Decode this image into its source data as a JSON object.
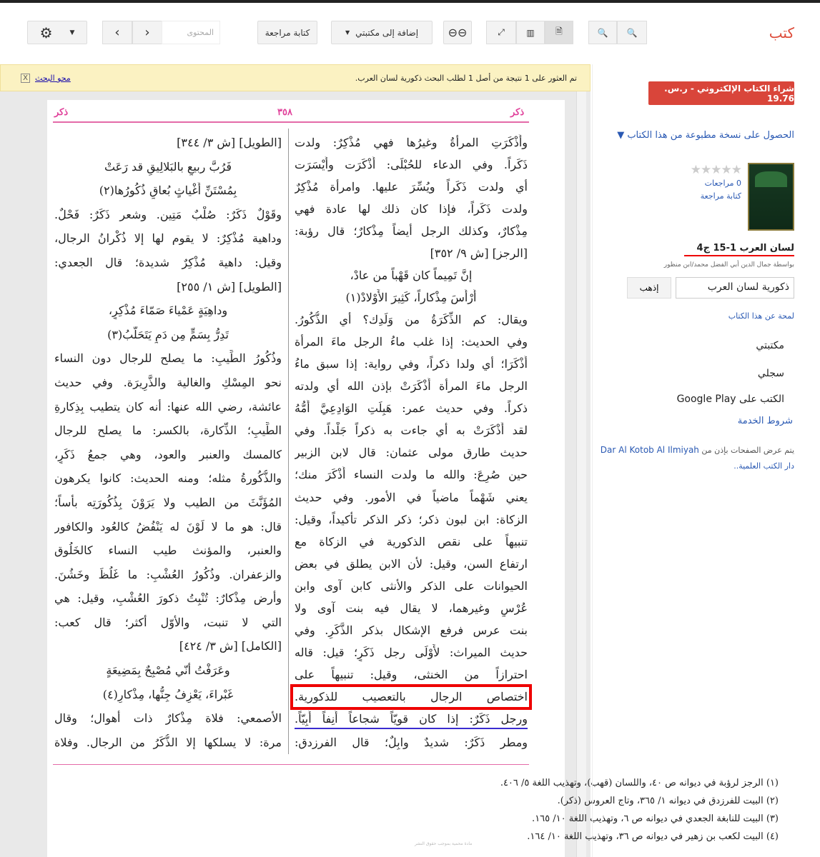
{
  "toolbar": {
    "logo": "كتب",
    "zoom_in": "zoom-in",
    "zoom_out": "zoom-out",
    "link": "link",
    "write_review": "كتابة مراجعة",
    "add_library": "إضافة إلى مكتبتي",
    "content_placeholder": "المحتوى"
  },
  "notice": {
    "msg": "تم العثور على 1 نتيجة من أصل 1 لطلب البحث ذكورية لسان العرب.",
    "clear": "محو البحث",
    "close": "X"
  },
  "page": {
    "header_left": "ذكر",
    "header_center": "٣٥٨",
    "header_right": "ذكر",
    "right_col": [
      "وأَذْكَرَتِ المرأةُ وغيرُها فهي مُذْكِرٌ: ولدت",
      "ذَكَراً. وفي الدعاء للحُبْلَى: أَذْكَرَت وأَيْسَرَت",
      "أي ولدت ذَكَراً ويُسِّرَ عليها. وامرأة مُذْكِرٌ",
      "ولدت ذَكَراً، فإذا كان ذلك لها عادة فهي",
      "مِذْكارٌ، وكذلك الرجل أيضاً مِذْكارٌ؛ قال رؤبة:",
      "[الرجز] [ش ٩/ ٣٥٢]",
      "إنَّ تَمِيماً كان قَهْباً من عادْ،",
      "أَرْأَسَ مِذْكاراً، كَثِيرَ الأَوْلادْ(١)",
      "ويقال: كم الذِّكَرَةُ من وَلَدِك؟ أي الذُّكُورُ.",
      "وفي الحديث: إذا غلب ماءُ الرجل ماءَ المرأة",
      "أَذْكَرَا؛ أي ولدا ذكراً، وفي رواية: إذا سبق ماءُ",
      "الرجل ماءَ المرأة أَذْكَرَتْ بإذن الله أي ولدته",
      "ذكراً. وفي حديث عمر: هَبِلَتِ الوَادِعِيَّ أُمُّهُ",
      "لقد أَذْكَرَتْ به أي جاءت به ذكراً جَلْداً. وفي",
      "حديث طارق مولى عثمان: قال لابن الزبير",
      "حين صُرِعَ: والله ما ولدت النساء أَذْكَرَ منك؛",
      "يعني شَهْماً ماضياً في الأمور. وفي حديث",
      "الزكاة: ابن لبون ذكر؛ ذكر الذكر تأكيداً، وقيل:",
      "تنبيهاً على نقص الذكورية في الزكاة مع",
      "ارتفاع السن، وقيل: لأن الابن يطلق في بعض",
      "الحيوانات على الذكر والأنثى كابن آوى وابن",
      "عُرْسٍ وغيرهما، لا يقال فيه بنت آوى ولا",
      "بنت عرس فرفع الإشكال بذكر الذَّكَرِ. وفي",
      "حديث الميراث: لأَوْلَى رجل ذَكَرٍ؛ قيل: قاله",
      "احترازاً من الخنثى، وقيل: تنبيهاً على",
      "اختصاص الرجال بالتعصيب للذكورية.",
      "ورجل ذَكَرٌ: إذا كان قويّاً شجاعاً أَنِفاً أَبِيّاً.",
      "ومطر ذَكَرٌ: شديدٌ وابِلٌ؛ قال الفرزدق:"
    ],
    "left_col": [
      "[الطويل] [ش ٣/ ٣٤٤]",
      "فَرُبَّ ربيعٍ بالبَلالِيقِ قد رَعَتْ",
      "بِمُسْتَنِّ أَغْياثٍ بُعاقٍ ذُكُورُها(٢)",
      "وقَوْلٌ ذَكَرٌ: صُلْبٌ مَتِين. وشعر ذَكَرٌ: فَحْلٌ.",
      "وداهية مُذْكِرٌ: لا يقوم لها إلا ذُكْرانُ الرجال،",
      "وقيل: داهية مُذْكِرٌ شديدة؛ قال الجعدي:",
      "[الطويل] [ش ١/ ٢٥٥]",
      "وداهِيَةٍ عَمْياءَ صَمّاءَ مُذْكِرٍ،",
      "تَدِرُّ بِسَمٍّ مِن دَمٍ يَتَحَلَّبُ(٣)",
      "وذُكُورُ الطِّيبِ: ما يصلح للرجال دون النساء",
      "نحو المِسْكِ والغالية والذَّرِيرَة. وفي حديث",
      "عائشة، رضي الله عنها: أنه كان يتطيب بِذِكارةِ",
      "الطِّيبِ؛ الذِّكارة، بالكسر: ما يصلح للرجال",
      "كالمسك والعنبر والعود، وهي جمعُ ذَكَرٍ،",
      "والذُّكُورةُ مثله؛ ومنه الحديث: كانوا يكرهون",
      "المُؤَنَّثَ من الطيب ولا يَرَوْنَ بِذُكُورَتِه بأساً؛",
      "قال: هو ما لا لَوْنَ له يَنْفُضُ كالعُود والكافور",
      "والعنبر، والمؤنث طيب النساء كالخَلُوق",
      "والزعفران. وذُكُورُ العُشْبِ: ما غَلُظَ وخَشُنَ.",
      "وأرض مِذْكارٌ: تُنْبِتُ ذكورَ العُشْبِ، وقيل: هي",
      "التي لا تنبت، والأوّل أكثر؛ قال كعب:",
      "[الكامل] [ش ٣/ ٤٢٤]",
      "وعَرَفْتُ أنّي مُصْبِحٌ بِمَضِيعَةٍ",
      "غَبْراءَ، يَعْزِفُ جِنُّها، مِذْكارِ(٤)",
      "الأصمعي: فلاة مِذْكارٌ ذات أهوال؛ وقال",
      "مرة: لا يسلكها إلا الذُّكَرُ من الرجال. وفلاة"
    ],
    "footnotes": [
      "(١) الرجز لرؤبة في ديوانه ص ٤٠، واللسان (قهب)، وتهذيب اللغة ٥/ ٤٠٦.",
      "(٢) البيت للفرزدق في ديوانه ١/ ٣٦٥، وتاج العروس (ذكر).",
      "(٣) البيت للنابغة الجعدي في ديوانه ص ٦، وتهذيب اللغة ١٠/ ١٦٥.",
      "(٤) البيت لكعب بن زهير في ديوانه ص ٣٦، وتهذيب اللغة ١٠/ ١٦٤."
    ],
    "watermark": "مادة محمية بموجب حقوق النشر"
  },
  "sidebar": {
    "buy": "شراء الكتاب الإلكتروني - ر.س. 19.76",
    "print_copy": "الحصول على نسخة مطبوعة من هذا الكتاب ▼",
    "rating": "★★★★★",
    "reviews": "0 مراجعات",
    "write_review": "كتابة مراجعة",
    "title": "لسان العرب 1-15 ج4",
    "author": "بواسطة جمال الدين أبي الفضل محمد/ابن منظور",
    "search_value": "ذكورية لسان العرب",
    "go": "إذهب",
    "about": "لمحة عن هذا الكتاب",
    "my_library": "مكتبتي",
    "history": "سجلي",
    "play": "الكتب على Google Play",
    "terms": "شروط الخدمة",
    "publisher_note": "يتم عرض الصفحات بإذن من",
    "publisher": "Dar Al Kotob Al Ilmiyah",
    "publisher_ar": "دار الكتب العلمية.."
  },
  "colors": {
    "accent": "#dd4b39",
    "pink": "#e0409a",
    "link": "#2a59b3"
  }
}
